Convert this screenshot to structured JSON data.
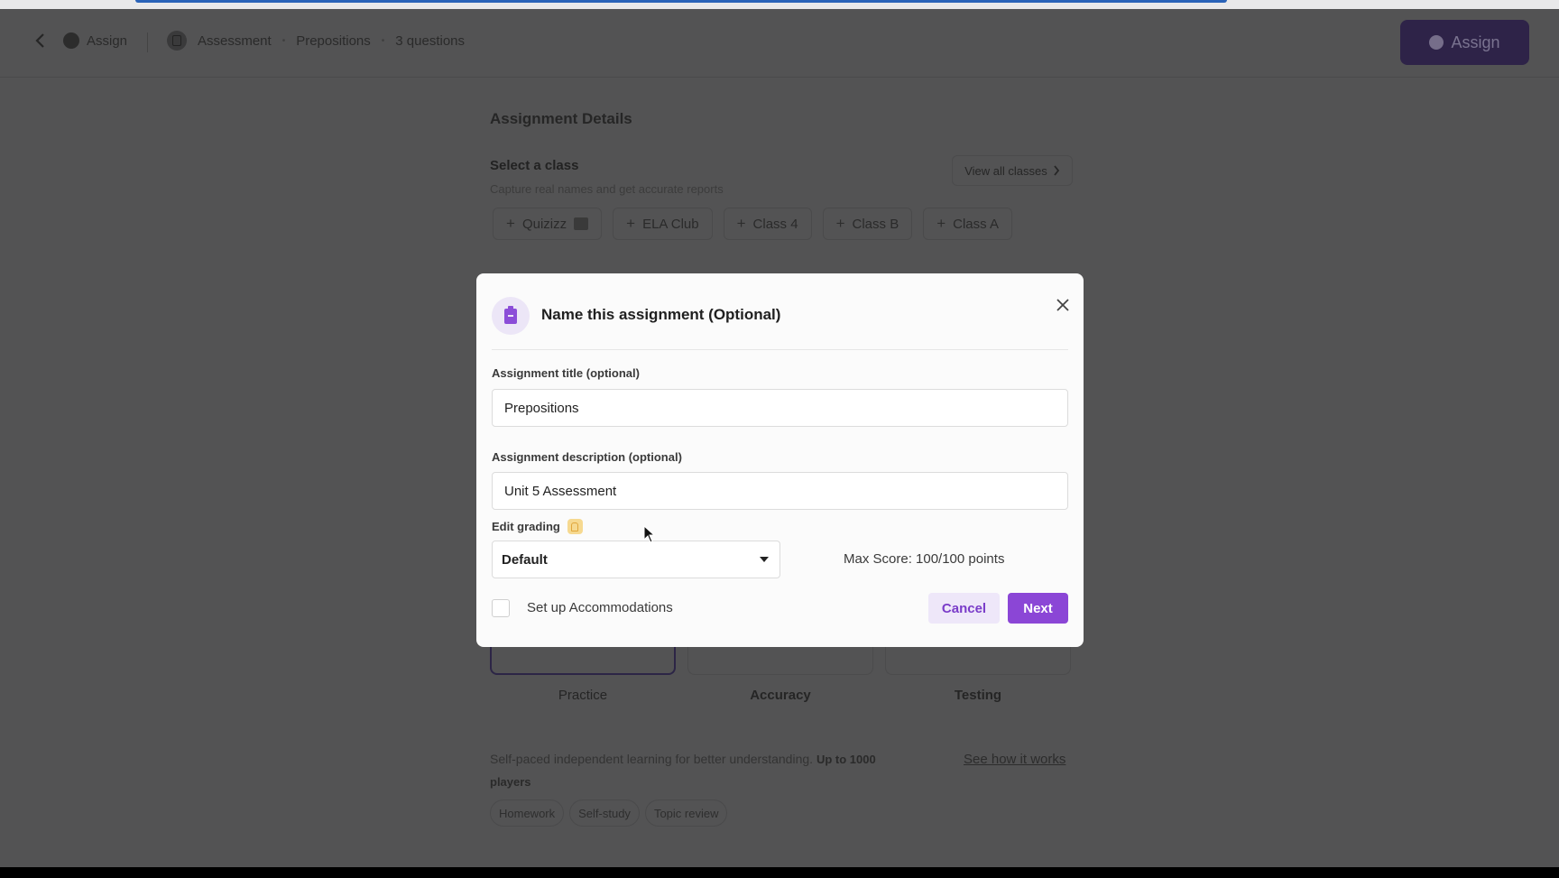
{
  "header": {
    "assign_crumb": "Assign",
    "breadcrumb": [
      "Assessment",
      "Prepositions",
      "3 questions"
    ],
    "assign_button": "Assign"
  },
  "details": {
    "title": "Assignment Details",
    "select_class_title": "Select a class",
    "select_class_sub": "Capture real names and get accurate reports",
    "view_all": "View all classes",
    "classes": [
      "Quizizz",
      "ELA Club",
      "Class 4",
      "Class B",
      "Class A"
    ]
  },
  "modes": [
    "Practice",
    "Accuracy",
    "Testing"
  ],
  "description": {
    "text": "Self-paced independent learning for better understanding.",
    "bold": "Up to 1000 players",
    "see_how": "See how it works"
  },
  "tags": [
    "Homework",
    "Self-study",
    "Topic review"
  ],
  "modal": {
    "title": "Name this assignment (Optional)",
    "title_label": "Assignment title (optional)",
    "title_value": "Prepositions",
    "desc_label": "Assignment description (optional)",
    "desc_value": "Unit 5 Assessment",
    "grading_label": "Edit grading",
    "grading_value": "Default",
    "max_score": "Max Score: 100/100 points",
    "accommodations": "Set up Accommodations",
    "cancel": "Cancel",
    "next": "Next"
  },
  "colors": {
    "accent": "#8b46d6",
    "accent_light": "#eee7f9",
    "overlay_bg": "#535354",
    "assign_btn_bg": "#2e2348"
  },
  "icons": [
    "back-arrow-icon",
    "assign-icon",
    "assessment-icon",
    "chevron-right-icon",
    "plus-icon",
    "clipboard-icon",
    "close-icon",
    "lightbulb-icon",
    "dropdown-caret-icon",
    "mouse-cursor-icon"
  ]
}
